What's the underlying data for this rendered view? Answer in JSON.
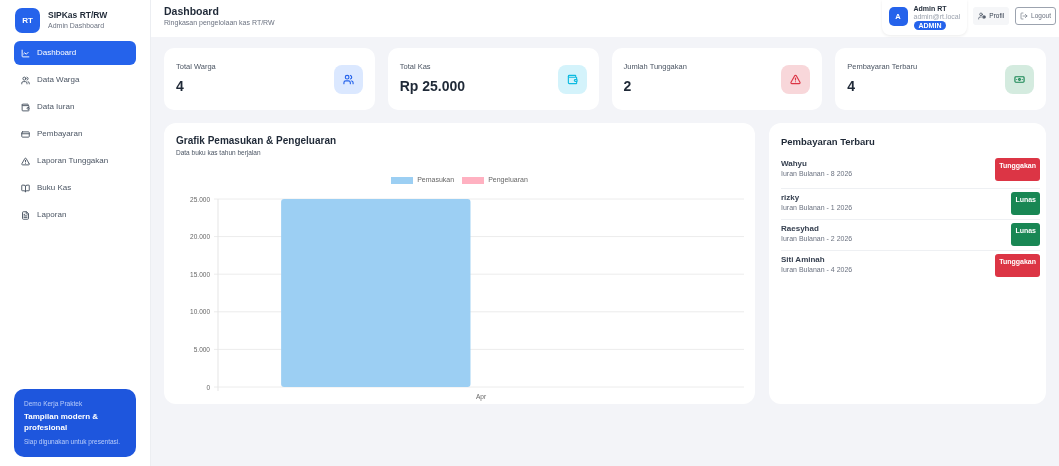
{
  "brand": {
    "logo": "RT",
    "name": "SIPKas RT/RW",
    "subtitle": "Admin Dashboard"
  },
  "sidebar": {
    "items": [
      {
        "label": "Dashboard",
        "selected": true
      },
      {
        "label": "Data Warga",
        "selected": false
      },
      {
        "label": "Data Iuran",
        "selected": false
      },
      {
        "label": "Pembayaran",
        "selected": false
      },
      {
        "label": "Laporan Tunggakan",
        "selected": false
      },
      {
        "label": "Buku Kas",
        "selected": false
      },
      {
        "label": "Laporan",
        "selected": false
      }
    ],
    "promo": {
      "eyebrow": "Demo Kerja Praktek",
      "title": "Tampilan modern & profesional",
      "text": "Siap digunakan untuk presentasi."
    }
  },
  "header": {
    "title": "Dashboard",
    "subtitle": "Ringkasan pengelolaan kas RT/RW",
    "user": {
      "initial": "A",
      "name": "Admin RT",
      "email": "admin@rt.local",
      "role": "ADMIN"
    },
    "buttons": {
      "profile": "Profil",
      "logout": "Logout"
    }
  },
  "stats": [
    {
      "label": "Total Warga",
      "value": "4",
      "kind": "people"
    },
    {
      "label": "Total Kas",
      "value": "Rp 25.000",
      "kind": "wallet"
    },
    {
      "label": "Jumlah Tunggakan",
      "value": "2",
      "kind": "warning"
    },
    {
      "label": "Pembayaran Terbaru",
      "value": "4",
      "kind": "money"
    }
  ],
  "chart_card": {
    "title": "Grafik Pemasukan & Pengeluaran",
    "subtitle": "Data buku kas tahun berjalan",
    "chart_data": {
      "type": "bar",
      "categories": [
        "Apr"
      ],
      "series": [
        {
          "name": "Pemasukan",
          "color": "#9ccff3",
          "values": [
            25000
          ]
        },
        {
          "name": "Pengeluaran",
          "color": "#ffb1c1",
          "values": [
            0
          ]
        }
      ],
      "ylim": [
        0,
        25000
      ],
      "grid": true,
      "yticks": [
        {
          "value": 0,
          "label": "0"
        },
        {
          "value": 5000,
          "label": "5.000"
        },
        {
          "value": 10000,
          "label": "10.000"
        },
        {
          "value": 15000,
          "label": "15.000"
        },
        {
          "value": 20000,
          "label": "20.000"
        },
        {
          "value": 25000,
          "label": "25.000"
        }
      ]
    }
  },
  "payments": {
    "title": "Pembayaran Terbaru",
    "rows": [
      {
        "name": "Wahyu",
        "detail": "Iuran Bulanan - 8 2026",
        "status": "Tunggakan",
        "kind": "unpaid"
      },
      {
        "name": "rizky",
        "detail": "Iuran Bulanan - 1 2026",
        "status": "Lunas",
        "kind": "paid"
      },
      {
        "name": "Raesyhad",
        "detail": "Iuran Bulanan - 2 2026",
        "status": "Lunas",
        "kind": "paid"
      },
      {
        "name": "Siti Aminah",
        "detail": "Iuran Bulanan - 4 2026",
        "status": "Tunggakan",
        "kind": "unpaid"
      }
    ]
  }
}
